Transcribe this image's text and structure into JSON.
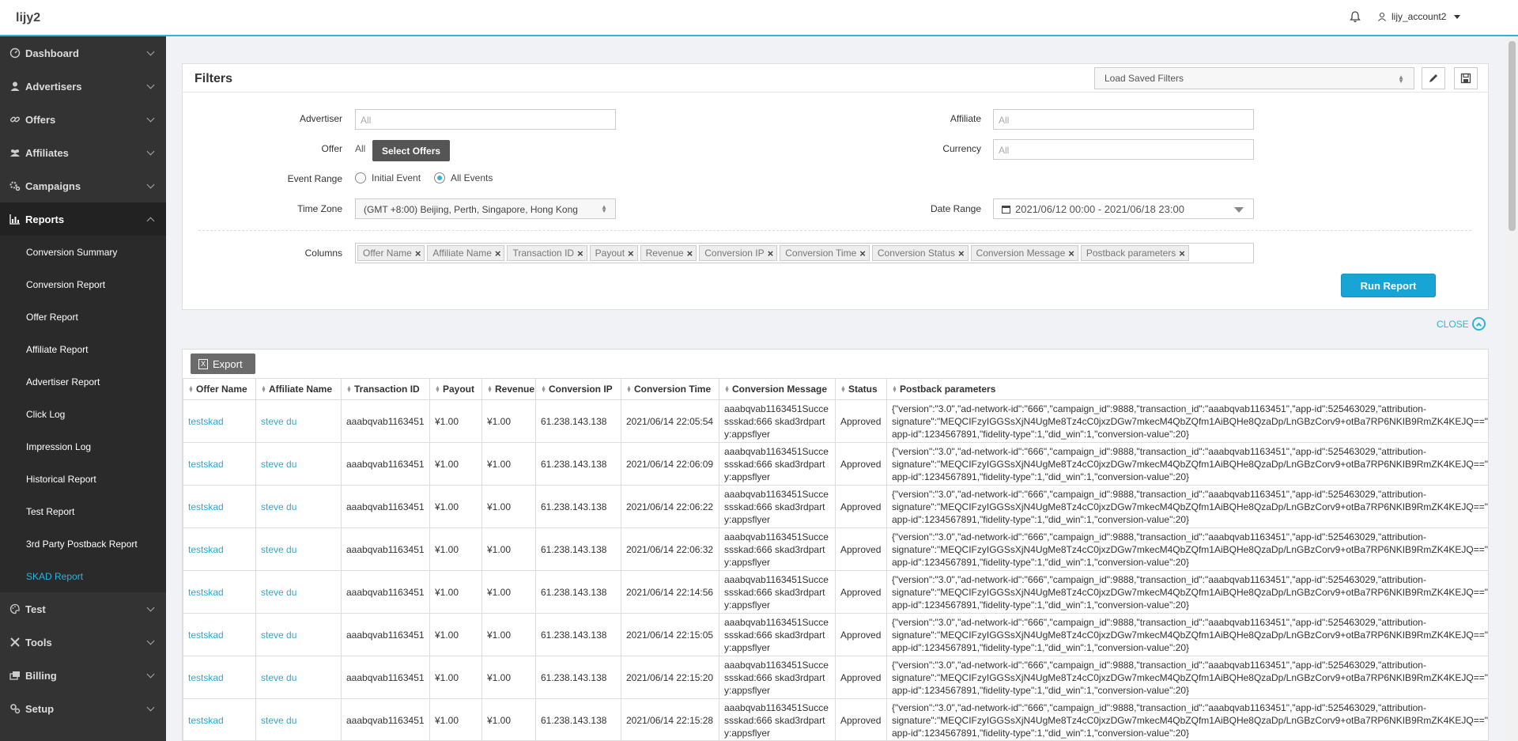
{
  "app": {
    "brand": "lijy2",
    "user": "lijy_account2"
  },
  "sidebar": {
    "top_items": [
      {
        "label": "Dashboard"
      },
      {
        "label": "Advertisers"
      },
      {
        "label": "Offers"
      },
      {
        "label": "Affiliates"
      },
      {
        "label": "Campaigns"
      }
    ],
    "open_item": {
      "label": "Reports"
    },
    "sub_items": [
      {
        "label": "Conversion Summary"
      },
      {
        "label": "Conversion Report"
      },
      {
        "label": "Offer Report"
      },
      {
        "label": "Affiliate Report"
      },
      {
        "label": "Advertiser Report"
      },
      {
        "label": "Click Log"
      },
      {
        "label": "Impression Log"
      },
      {
        "label": "Historical Report"
      },
      {
        "label": "Test Report"
      },
      {
        "label": "3rd Party Postback Report"
      },
      {
        "label": "SKAD Report"
      }
    ],
    "bottom_items": [
      {
        "label": "Test"
      },
      {
        "label": "Tools"
      },
      {
        "label": "Billing"
      },
      {
        "label": "Setup"
      }
    ],
    "accent_color": "#2fb3d8"
  },
  "filters": {
    "title": "Filters",
    "saved_filters_placeholder": "Load Saved Filters",
    "advertiser_label": "Advertiser",
    "advertiser_placeholder": "All",
    "affiliate_label": "Affiliate",
    "affiliate_placeholder": "All",
    "offer_label": "Offer",
    "offer_value": "All",
    "select_offers_label": "Select Offers",
    "currency_label": "Currency",
    "currency_placeholder": "All",
    "event_range_label": "Event Range",
    "event_initial": "Initial Event",
    "event_all": "All Events",
    "timezone_label": "Time Zone",
    "timezone_value": "(GMT +8:00) Beijing, Perth, Singapore, Hong Kong",
    "date_range_label": "Date Range",
    "date_range_value": "2021/06/12 00:00 - 2021/06/18 23:00",
    "columns_label": "Columns",
    "columns": [
      "Offer Name",
      "Affiliate Name",
      "Transaction ID",
      "Payout",
      "Revenue",
      "Conversion IP",
      "Conversion Time",
      "Conversion Status",
      "Conversion Message",
      "Postback parameters"
    ],
    "run_report_label": "Run Report",
    "close_label": "CLOSE"
  },
  "table": {
    "export_label": "Export",
    "headers": [
      "Offer Name",
      "Affiliate Name",
      "Transaction ID",
      "Payout",
      "Revenue",
      "Conversion IP",
      "Conversion Time",
      "Conversion Message",
      "Status",
      "Postback parameters"
    ],
    "rows": [
      {
        "offer": "testskad",
        "affiliate": "steve du",
        "txn": "aaabqvab1163451",
        "payout": "¥1.00",
        "revenue": "¥1.00",
        "ip": "61.238.143.138",
        "time": "2021/06/14 22:05:54",
        "msg": [
          "aaabqvab1163451Succe",
          "ssskad:666 skad3rdpart",
          "y:appsflyer"
        ],
        "status": "Approved",
        "pb": [
          "{\"version\":\"3.0\",\"ad-network-id\":\"666\",\"campaign_id\":9888,\"transaction_id\":\"aaabqvab1163451\",\"app-id\":525463029,\"attribution-",
          "signature\":\"MEQCIFzyIGGSsXjN4UgMe8Tz4cC0jxzDGw7mkecM4QbZQfm1AiBQHe8QzaDp/LnGBzCorv9+otBa7RP6NKIB9RmZK4KEJQ==\",\"redownload\":true,\"source-",
          "app-id\":1234567891,\"fidelity-type\":1,\"did_win\":1,\"conversion-value\":20}"
        ]
      },
      {
        "offer": "testskad",
        "affiliate": "steve du",
        "txn": "aaabqvab1163451",
        "payout": "¥1.00",
        "revenue": "¥1.00",
        "ip": "61.238.143.138",
        "time": "2021/06/14 22:06:09",
        "msg": [
          "aaabqvab1163451Succe",
          "ssskad:666 skad3rdpart",
          "y:appsflyer"
        ],
        "status": "Approved",
        "pb": [
          "{\"version\":\"3.0\",\"ad-network-id\":\"666\",\"campaign_id\":9888,\"transaction_id\":\"aaabqvab1163451\",\"app-id\":525463029,\"attribution-",
          "signature\":\"MEQCIFzyIGGSsXjN4UgMe8Tz4cC0jxzDGw7mkecM4QbZQfm1AiBQHe8QzaDp/LnGBzCorv9+otBa7RP6NKIB9RmZK4KEJQ==\",\"redownload\":true,\"source-",
          "app-id\":1234567891,\"fidelity-type\":1,\"did_win\":1,\"conversion-value\":20}"
        ]
      },
      {
        "offer": "testskad",
        "affiliate": "steve du",
        "txn": "aaabqvab1163451",
        "payout": "¥1.00",
        "revenue": "¥1.00",
        "ip": "61.238.143.138",
        "time": "2021/06/14 22:06:22",
        "msg": [
          "aaabqvab1163451Succe",
          "ssskad:666 skad3rdpart",
          "y:appsflyer"
        ],
        "status": "Approved",
        "pb": [
          "{\"version\":\"3.0\",\"ad-network-id\":\"666\",\"campaign_id\":9888,\"transaction_id\":\"aaabqvab1163451\",\"app-id\":525463029,\"attribution-",
          "signature\":\"MEQCIFzyIGGSsXjN4UgMe8Tz4cC0jxzDGw7mkecM4QbZQfm1AiBQHe8QzaDp/LnGBzCorv9+otBa7RP6NKIB9RmZK4KEJQ==\",\"redownload\":true,\"source-",
          "app-id\":1234567891,\"fidelity-type\":1,\"did_win\":1,\"conversion-value\":20}"
        ]
      },
      {
        "offer": "testskad",
        "affiliate": "steve du",
        "txn": "aaabqvab1163451",
        "payout": "¥1.00",
        "revenue": "¥1.00",
        "ip": "61.238.143.138",
        "time": "2021/06/14 22:06:32",
        "msg": [
          "aaabqvab1163451Succe",
          "ssskad:666 skad3rdpart",
          "y:appsflyer"
        ],
        "status": "Approved",
        "pb": [
          "{\"version\":\"3.0\",\"ad-network-id\":\"666\",\"campaign_id\":9888,\"transaction_id\":\"aaabqvab1163451\",\"app-id\":525463029,\"attribution-",
          "signature\":\"MEQCIFzyIGGSsXjN4UgMe8Tz4cC0jxzDGw7mkecM4QbZQfm1AiBQHe8QzaDp/LnGBzCorv9+otBa7RP6NKIB9RmZK4KEJQ==\",\"redownload\":true,\"source-",
          "app-id\":1234567891,\"fidelity-type\":1,\"did_win\":1,\"conversion-value\":20}"
        ]
      },
      {
        "offer": "testskad",
        "affiliate": "steve du",
        "txn": "aaabqvab1163451",
        "payout": "¥1.00",
        "revenue": "¥1.00",
        "ip": "61.238.143.138",
        "time": "2021/06/14 22:14:56",
        "msg": [
          "aaabqvab1163451Succe",
          "ssskad:666 skad3rdpart",
          "y:appsflyer"
        ],
        "status": "Approved",
        "pb": [
          "{\"version\":\"3.0\",\"ad-network-id\":\"666\",\"campaign_id\":9888,\"transaction_id\":\"aaabqvab1163451\",\"app-id\":525463029,\"attribution-",
          "signature\":\"MEQCIFzyIGGSsXjN4UgMe8Tz4cC0jxzDGw7mkecM4QbZQfm1AiBQHe8QzaDp/LnGBzCorv9+otBa7RP6NKIB9RmZK4KEJQ==\",\"redownload\":true,\"source-",
          "app-id\":1234567891,\"fidelity-type\":1,\"did_win\":1,\"conversion-value\":20}"
        ]
      },
      {
        "offer": "testskad",
        "affiliate": "steve du",
        "txn": "aaabqvab1163451",
        "payout": "¥1.00",
        "revenue": "¥1.00",
        "ip": "61.238.143.138",
        "time": "2021/06/14 22:15:05",
        "msg": [
          "aaabqvab1163451Succe",
          "ssskad:666 skad3rdpart",
          "y:appsflyer"
        ],
        "status": "Approved",
        "pb": [
          "{\"version\":\"3.0\",\"ad-network-id\":\"666\",\"campaign_id\":9888,\"transaction_id\":\"aaabqvab1163451\",\"app-id\":525463029,\"attribution-",
          "signature\":\"MEQCIFzyIGGSsXjN4UgMe8Tz4cC0jxzDGw7mkecM4QbZQfm1AiBQHe8QzaDp/LnGBzCorv9+otBa7RP6NKIB9RmZK4KEJQ==\",\"redownload\":true,\"source-",
          "app-id\":1234567891,\"fidelity-type\":1,\"did_win\":1,\"conversion-value\":20}"
        ]
      },
      {
        "offer": "testskad",
        "affiliate": "steve du",
        "txn": "aaabqvab1163451",
        "payout": "¥1.00",
        "revenue": "¥1.00",
        "ip": "61.238.143.138",
        "time": "2021/06/14 22:15:20",
        "msg": [
          "aaabqvab1163451Succe",
          "ssskad:666 skad3rdpart",
          "y:appsflyer"
        ],
        "status": "Approved",
        "pb": [
          "{\"version\":\"3.0\",\"ad-network-id\":\"666\",\"campaign_id\":9888,\"transaction_id\":\"aaabqvab1163451\",\"app-id\":525463029,\"attribution-",
          "signature\":\"MEQCIFzyIGGSsXjN4UgMe8Tz4cC0jxzDGw7mkecM4QbZQfm1AiBQHe8QzaDp/LnGBzCorv9+otBa7RP6NKIB9RmZK4KEJQ==\",\"redownload\":true,\"source-",
          "app-id\":1234567891,\"fidelity-type\":1,\"did_win\":1,\"conversion-value\":20}"
        ]
      },
      {
        "offer": "testskad",
        "affiliate": "steve du",
        "txn": "aaabqvab1163451",
        "payout": "¥1.00",
        "revenue": "¥1.00",
        "ip": "61.238.143.138",
        "time": "2021/06/14 22:15:28",
        "msg": [
          "aaabqvab1163451Succe",
          "ssskad:666 skad3rdpart",
          "y:appsflyer"
        ],
        "status": "Approved",
        "pb": [
          "{\"version\":\"3.0\",\"ad-network-id\":\"666\",\"campaign_id\":9888,\"transaction_id\":\"aaabqvab1163451\",\"app-id\":525463029,\"attribution-",
          "signature\":\"MEQCIFzyIGGSsXjN4UgMe8Tz4cC0jxzDGw7mkecM4QbZQfm1AiBQHe8QzaDp/LnGBzCorv9+otBa7RP6NKIB9RmZK4KEJQ==\",\"redownload\":true,\"source-",
          "app-id\":1234567891,\"fidelity-type\":1,\"did_win\":1,\"conversion-value\":20}"
        ]
      }
    ]
  }
}
